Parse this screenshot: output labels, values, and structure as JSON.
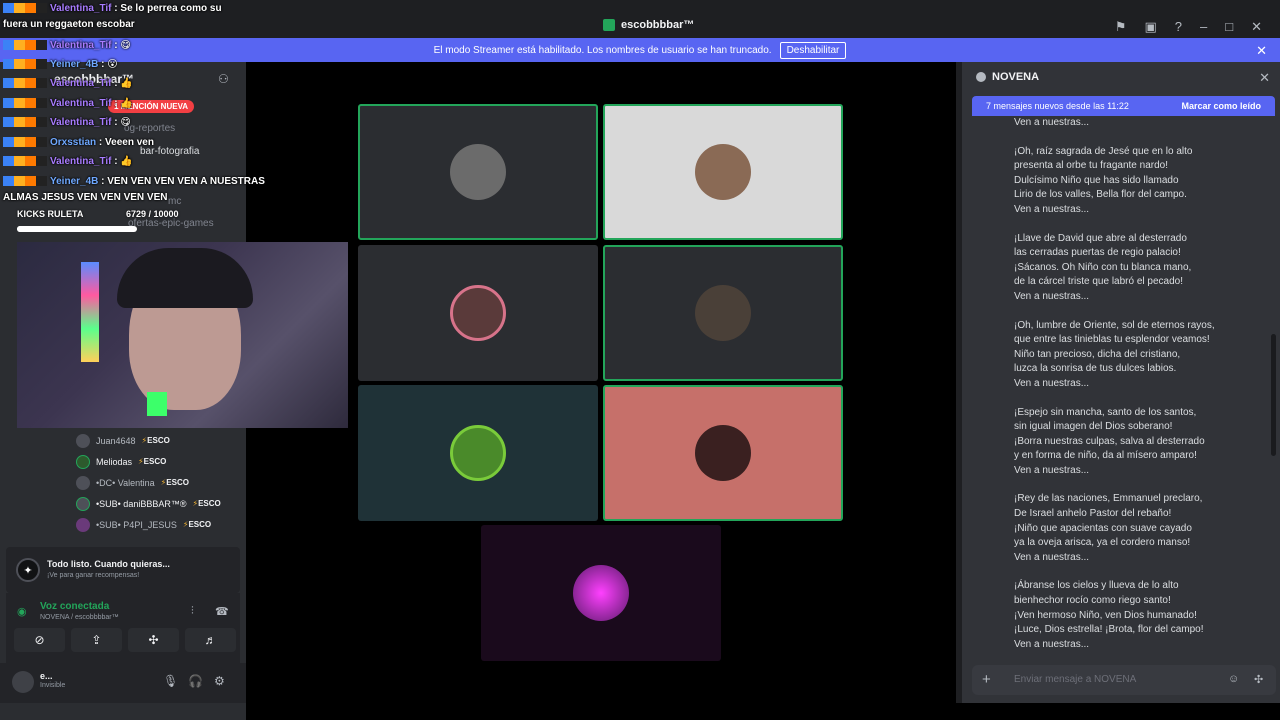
{
  "window": {
    "server_name": "escobbbbar™",
    "icons": [
      "flag-icon",
      "inbox-icon",
      "help-icon",
      "minimize-icon",
      "maximize-icon",
      "close-icon"
    ]
  },
  "streamer_bar": {
    "message": "El modo Streamer está habilitado. Los nombres de usuario se han truncado.",
    "button": "Deshabilitar"
  },
  "sidebar": {
    "header": "escobbbbar™",
    "mention_pill": "1 MENCIÓN NUEVA",
    "channels": [
      "og-reportes",
      "bar-fotografia",
      "mc",
      "ofertas-epic-games"
    ],
    "voice_users": [
      {
        "name": "Juan4648",
        "tag": "ESCO"
      },
      {
        "name": "Meliodas",
        "tag": "ESCO"
      },
      {
        "name": "•DC• Valentina",
        "tag": "ESCO"
      },
      {
        "name": "•SUB• daniBBBAR™®",
        "tag": "ESCO"
      },
      {
        "name": "•SUB• P4PI_JESUS",
        "tag": "ESCO"
      }
    ],
    "activity": {
      "title": "Todo listo. Cuando quieras...",
      "subtitle": "¡Ve para ganar recompensas!"
    },
    "voice": {
      "status": "Voz conectada",
      "channel": "NOVENA / escobbbbar™"
    },
    "user": {
      "name": "e...",
      "status": "Invisible"
    }
  },
  "overlay": {
    "chat_lines": [
      {
        "user": "Valentina_Tif",
        "text": "Se lo perrea como su"
      },
      {
        "user": "",
        "text": "fuera un reggaeton escobar"
      },
      {
        "user": "Valentina_Tif",
        "text": "😋"
      },
      {
        "user": "Yeiner_4B",
        "text": "😮"
      },
      {
        "user": "Valentina_Tif",
        "text": "👍"
      },
      {
        "user": "Valentina_Tif",
        "text": "👍"
      },
      {
        "user": "Valentina_Tif",
        "text": "😋"
      },
      {
        "user": "Orxsstian",
        "text": "Veeen ven"
      },
      {
        "user": "Valentina_Tif",
        "text": "👍"
      },
      {
        "user": "Yeiner_4B",
        "text": "VEN VEN VEN VEN A NUESTRAS"
      },
      {
        "user": "",
        "text": "ALMAS JESUS VEN VEN VEN VEN"
      }
    ],
    "kicks_label": "KICKS RULETA",
    "kicks_value": "6729 / 10000",
    "kicks_progress": 0.6729
  },
  "chat": {
    "title": "NOVENA",
    "new_messages": "7 mensajes nuevos desde las 11:22",
    "mark_read": "Marcar como leído",
    "input_placeholder": "Enviar mensaje a NOVENA",
    "stanzas": [
      [
        "Ven a nuestras..."
      ],
      [
        "¡Oh, raíz sagrada de Jesé que en lo alto",
        "presenta al orbe tu fragante nardo!",
        "Dulcísimo Niño que has sido llamado",
        "Lirio de los valles, Bella flor del campo.",
        "Ven a nuestras..."
      ],
      [
        "¡Llave de David que abre al desterrado",
        "las cerradas puertas de regio palacio!",
        "¡Sácanos. Oh Niño con tu blanca mano,",
        "de la cárcel triste que labró el pecado!",
        "Ven a nuestras..."
      ],
      [
        "¡Oh, lumbre de Oriente, sol de eternos rayos,",
        "que entre las tinieblas tu esplendor veamos!",
        "Niño tan precioso, dicha del cristiano,",
        "luzca la sonrisa de tus dulces labios.",
        "Ven a nuestras..."
      ],
      [
        "¡Espejo sin mancha, santo de los santos,",
        "sin igual imagen del Dios soberano!",
        "¡Borra nuestras culpas, salva al desterrado",
        "y en forma de niño, da al mísero amparo!",
        "Ven a nuestras..."
      ],
      [
        "¡Rey de las naciones, Emmanuel preclaro,",
        "De Israel anhelo Pastor del rebaño!",
        "¡Niño que apacientas con suave cayado",
        "ya la oveja arisca, ya el cordero manso!",
        "Ven a nuestras..."
      ],
      [
        "¡Ábranse los cielos y llueva de lo alto",
        "bienhechor rocío como riego santo!",
        "¡Ven hermoso Niño, ven Dios humanado!",
        "¡Luce, Dios estrella! ¡Brota, flor del campo!",
        "Ven a nuestras..."
      ]
    ]
  },
  "colors": {
    "accent": "#5865f2",
    "speaking": "#23a55a",
    "tile_dark": "#2b2d31",
    "tile_light": "#d9d9d9",
    "tile_teal": "#1f3237",
    "tile_red": "#c6706a",
    "tile_purple": "#1a0a1c"
  }
}
